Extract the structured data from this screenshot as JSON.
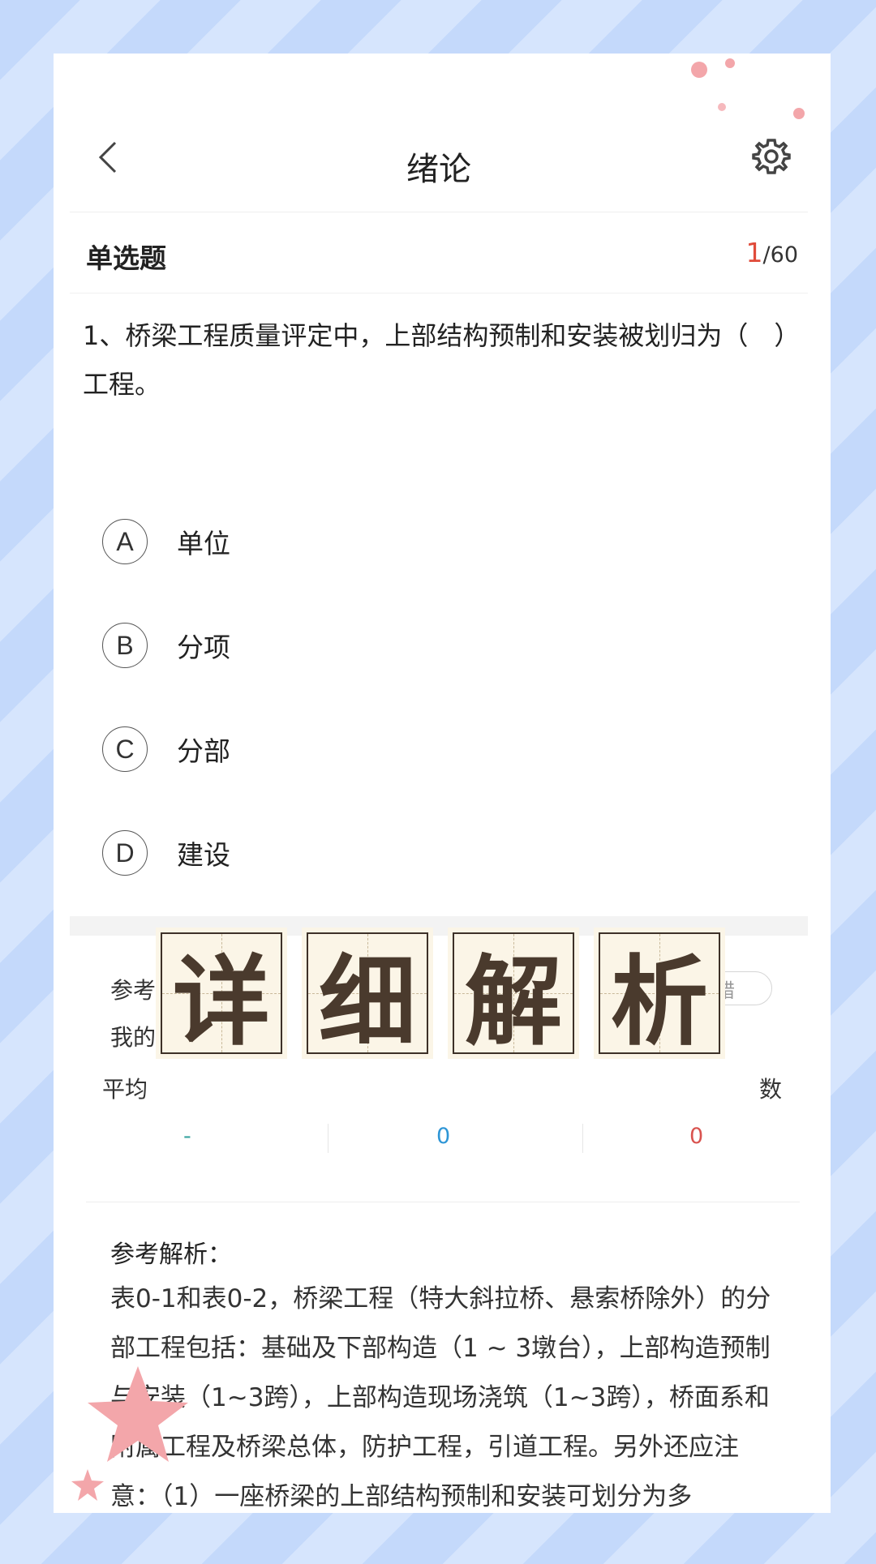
{
  "header": {
    "title": "绪论"
  },
  "question": {
    "type": "单选题",
    "current": "1",
    "total": "/60",
    "text": "1、桥梁工程质量评定中，上部结构预制和安装被划归为（　）工程。"
  },
  "options": [
    {
      "letter": "A",
      "text": "单位"
    },
    {
      "letter": "B",
      "text": "分项"
    },
    {
      "letter": "C",
      "text": "分部"
    },
    {
      "letter": "D",
      "text": "建设"
    }
  ],
  "answer": {
    "ref_label": "参考答案",
    "my_label": "我的",
    "report_label": "纠错",
    "stats": [
      {
        "label": "平均",
        "value": "-",
        "color": "#3aa5a0"
      },
      {
        "label": "",
        "value": "0",
        "color": "#2e96d6"
      },
      {
        "label": "数",
        "value": "0",
        "color": "#d9534f"
      }
    ]
  },
  "overlay": {
    "chars": [
      "详",
      "细",
      "解",
      "析"
    ]
  },
  "analysis": {
    "title": "参考解析：",
    "text": "表0-1和表0-2，桥梁工程（特大斜拉桥、悬索桥除外）的分部工程包括：基础及下部构造（1 ~ 3墩台），上部构造预制与安装（1~3跨），上部构造现场浇筑（1~3跨），桥面系和附属工程及桥梁总体，防护工程，引道工程。另外还应注意：（1）一座桥梁的上部结构预制和安装可划分为多"
  }
}
